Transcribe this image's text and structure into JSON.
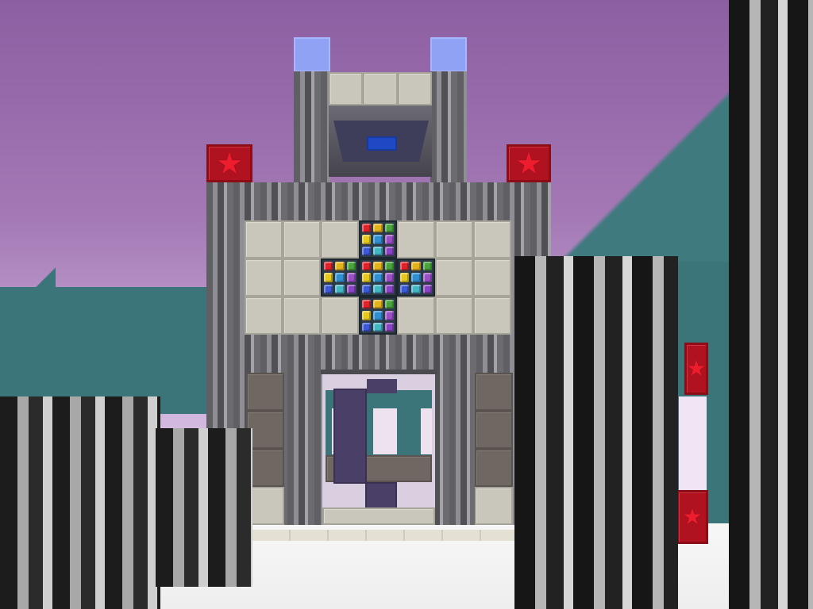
{
  "scene": {
    "title": "",
    "colors": {
      "sky_top": "#8c5fa2",
      "sky_bottom": "#f6eefa",
      "teal_block": "#3b7479",
      "snow": "#f2f2f2",
      "star_red": "#b01220",
      "beacon_blue": "#8fa2f4"
    },
    "icons": [
      "star-icon",
      "gem-block"
    ],
    "gem_colors": [
      "#e0232b",
      "#e6b21c",
      "#48a53a",
      "#e6c81d",
      "#2f8fd0",
      "#9a4ec7",
      "#3a59d6",
      "#43b6c6",
      "#8a43c4"
    ]
  }
}
